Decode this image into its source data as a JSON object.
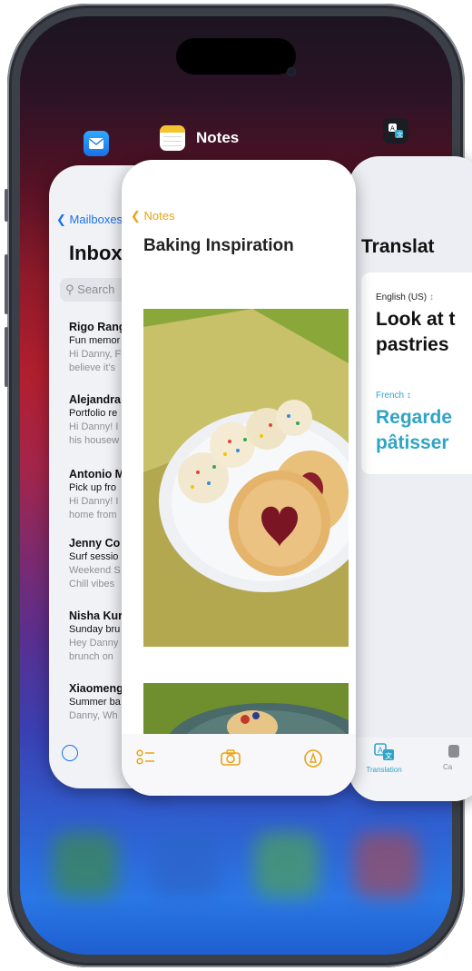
{
  "switcher": {
    "icons": [
      "mail-icon",
      "notes-icon",
      "translate-icon"
    ],
    "active_app_label": "Notes"
  },
  "mail": {
    "back_label": "Mailboxes",
    "title": "Inbox",
    "search_placeholder": "Search",
    "messages": [
      {
        "sender": "Rigo Rang",
        "subject": "Fun memor",
        "preview1": "Hi Danny, F",
        "preview2": "believe it’s"
      },
      {
        "sender": "Alejandra",
        "subject": "Portfolio re",
        "preview1": "Hi Danny! I",
        "preview2": "his housew"
      },
      {
        "sender": "Antonio M",
        "subject": "Pick up fro",
        "preview1": "Hi Danny! I",
        "preview2": "home from"
      },
      {
        "sender": "Jenny Co",
        "subject": "Surf sessio",
        "preview1": "Weekend S",
        "preview2": "Chill vibes"
      },
      {
        "sender": "Nisha Kur",
        "subject": "Sunday bru",
        "preview1": "Hey Danny",
        "preview2": "brunch on"
      },
      {
        "sender": "Xiaomeng",
        "subject": "Summer ba",
        "preview1": "Danny, Wh",
        "preview2": ""
      }
    ]
  },
  "notes": {
    "back_label": "Notes",
    "title": "Baking Inspiration",
    "toolbar_icons": [
      "checklist-icon",
      "camera-icon",
      "markup-icon"
    ]
  },
  "translate": {
    "title": "Translat",
    "source_lang": "English (US)",
    "source_text": "Look at t\npastries",
    "target_lang": "French",
    "target_text": "Regarde\npâtisser",
    "tab_label": "Translation",
    "tab_label_2": "Ca",
    "accent": "#30a4c6"
  },
  "colors": {
    "notes_accent": "#e8a413",
    "mail_accent": "#1a73e8"
  }
}
